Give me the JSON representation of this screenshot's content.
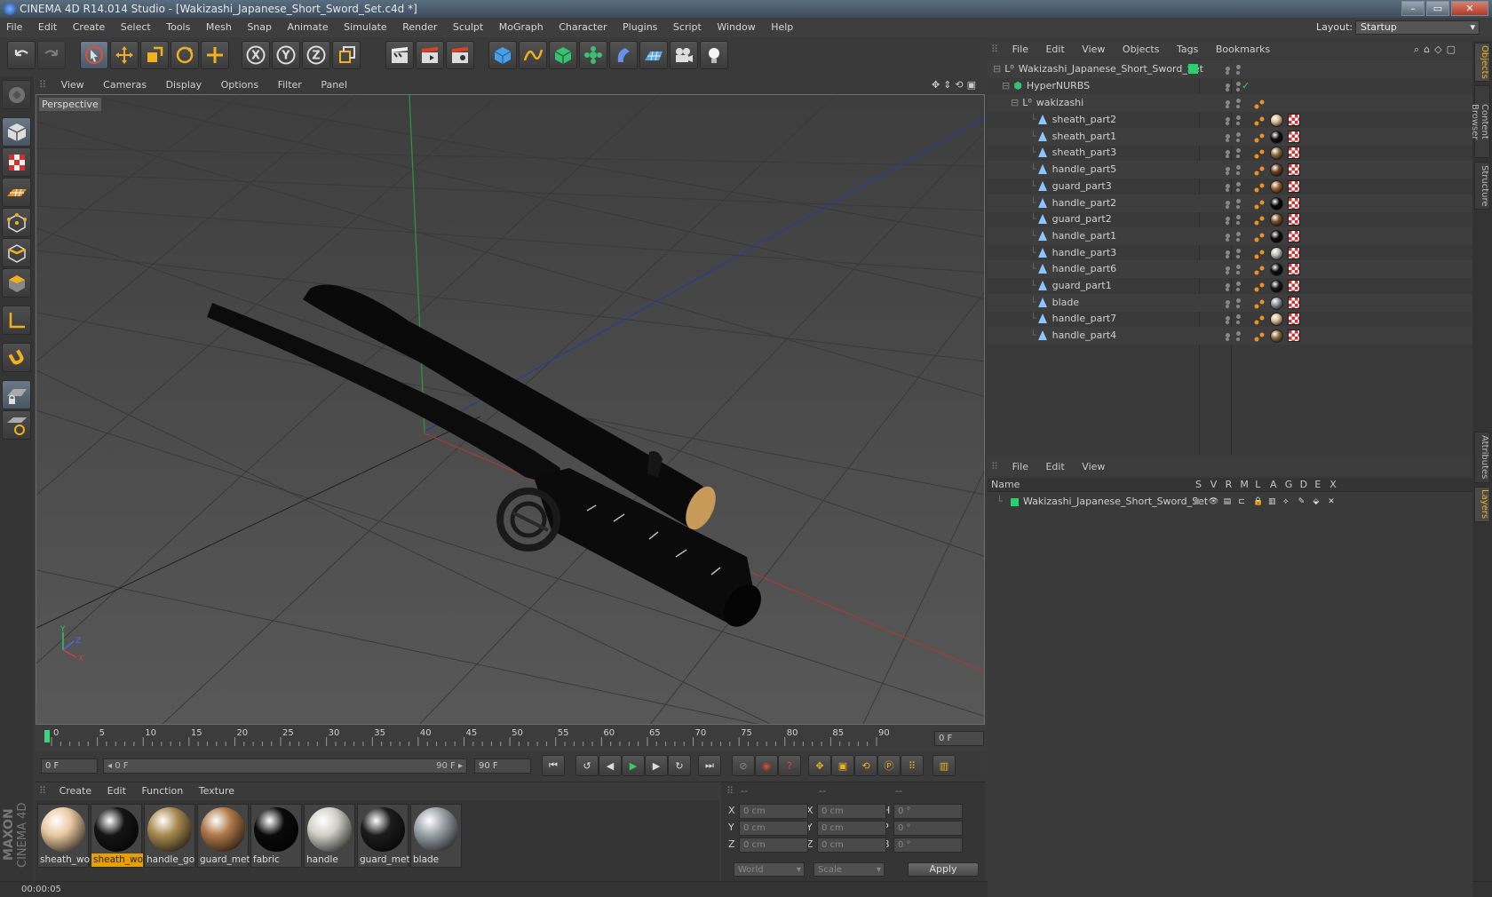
{
  "window": {
    "title": "CINEMA 4D R14.014 Studio - [Wakizashi_Japanese_Short_Sword_Set.c4d *]",
    "controls": [
      "–",
      "▭",
      "✕"
    ]
  },
  "menubar": [
    "File",
    "Edit",
    "Create",
    "Select",
    "Tools",
    "Mesh",
    "Snap",
    "Animate",
    "Simulate",
    "Render",
    "Sculpt",
    "MoGraph",
    "Character",
    "Plugins",
    "Script",
    "Window",
    "Help"
  ],
  "layout": {
    "label": "Layout:",
    "value": "Startup"
  },
  "toolbar": {
    "axis_labels": [
      "X",
      "Y",
      "Z"
    ]
  },
  "viewport": {
    "menu": [
      "View",
      "Cameras",
      "Display",
      "Options",
      "Filter",
      "Panel"
    ],
    "label": "Perspective",
    "axes": {
      "x": "X",
      "y": "Y",
      "z": "Z"
    }
  },
  "timeline": {
    "ticks": [
      "0",
      "5",
      "10",
      "15",
      "20",
      "25",
      "30",
      "35",
      "40",
      "45",
      "50",
      "55",
      "60",
      "65",
      "70",
      "75",
      "80",
      "85",
      "90"
    ],
    "current_frame": "0 F"
  },
  "transport": {
    "start_frame": "0 F",
    "range_start": "◂ 0 F",
    "range_end": "90 F ▸",
    "end_frame": "90 F"
  },
  "materials": {
    "menu": [
      "Create",
      "Edit",
      "Function",
      "Texture"
    ],
    "items": [
      {
        "name": "sheath_wo",
        "color": "#e8c8a0",
        "selected": false
      },
      {
        "name": "sheath_wo",
        "color": "#151515",
        "selected": true
      },
      {
        "name": "handle_go",
        "color": "#a88a50",
        "selected": false
      },
      {
        "name": "guard_met",
        "color": "#b0784a",
        "selected": false
      },
      {
        "name": "fabric",
        "color": "#0a0a0a",
        "selected": false
      },
      {
        "name": "handle",
        "color": "#d0d0c8",
        "selected": false
      },
      {
        "name": "guard_met",
        "color": "#1c1c1c",
        "selected": false
      },
      {
        "name": "blade",
        "color": "#9aa0a8",
        "selected": false
      }
    ]
  },
  "coords": {
    "headers": [
      "--",
      "--",
      "--"
    ],
    "rows": [
      {
        "l1": "X",
        "v1": "0 cm",
        "l2": "X",
        "v2": "0 cm",
        "l3": "H",
        "v3": "0 °"
      },
      {
        "l1": "Y",
        "v1": "0 cm",
        "l2": "Y",
        "v2": "0 cm",
        "l3": "P",
        "v3": "0 °"
      },
      {
        "l1": "Z",
        "v1": "0 cm",
        "l2": "Z",
        "v2": "0 cm",
        "l3": "B",
        "v3": "0 °"
      }
    ],
    "mode": "World",
    "scale": "Scale",
    "apply": "Apply"
  },
  "status": {
    "time": "00:00:05"
  },
  "objects": {
    "menu": [
      "File",
      "Edit",
      "View",
      "Objects",
      "Tags",
      "Bookmarks"
    ],
    "root": "Wakizashi_Japanese_Short_Sword_Set",
    "hypernurbs": "HyperNURBS",
    "group": "wakizashi",
    "children": [
      {
        "name": "sheath_part2",
        "mat": "#d8b890"
      },
      {
        "name": "sheath_part1",
        "mat": "#101010"
      },
      {
        "name": "sheath_part3",
        "mat": "#8a6a3a"
      },
      {
        "name": "handle_part5",
        "mat": "#6a4020"
      },
      {
        "name": "guard_part3",
        "mat": "#9a6030"
      },
      {
        "name": "handle_part2",
        "mat": "#0a0a0a"
      },
      {
        "name": "guard_part2",
        "mat": "#7a5028"
      },
      {
        "name": "handle_part1",
        "mat": "#0e0e0e"
      },
      {
        "name": "handle_part3",
        "mat": "#b8b8b0"
      },
      {
        "name": "handle_part6",
        "mat": "#101010"
      },
      {
        "name": "guard_part1",
        "mat": "#181818"
      },
      {
        "name": "blade",
        "mat": "#8a9098"
      },
      {
        "name": "handle_part7",
        "mat": "#d8b890"
      },
      {
        "name": "handle_part4",
        "mat": "#8a6a3a"
      }
    ]
  },
  "layers": {
    "menu": [
      "File",
      "Edit",
      "View"
    ],
    "name_header": "Name",
    "col_headers": [
      "S",
      "V",
      "R",
      "M",
      "L",
      "A",
      "G",
      "D",
      "E",
      "X"
    ],
    "row": "Wakizashi_Japanese_Short_Sword_Set"
  },
  "sidetabs": [
    "Objects",
    "Content Browser",
    "Structure",
    "Attributes",
    "Layers"
  ],
  "brand": {
    "line1": "MAXON",
    "line2": "CINEMA 4D"
  }
}
